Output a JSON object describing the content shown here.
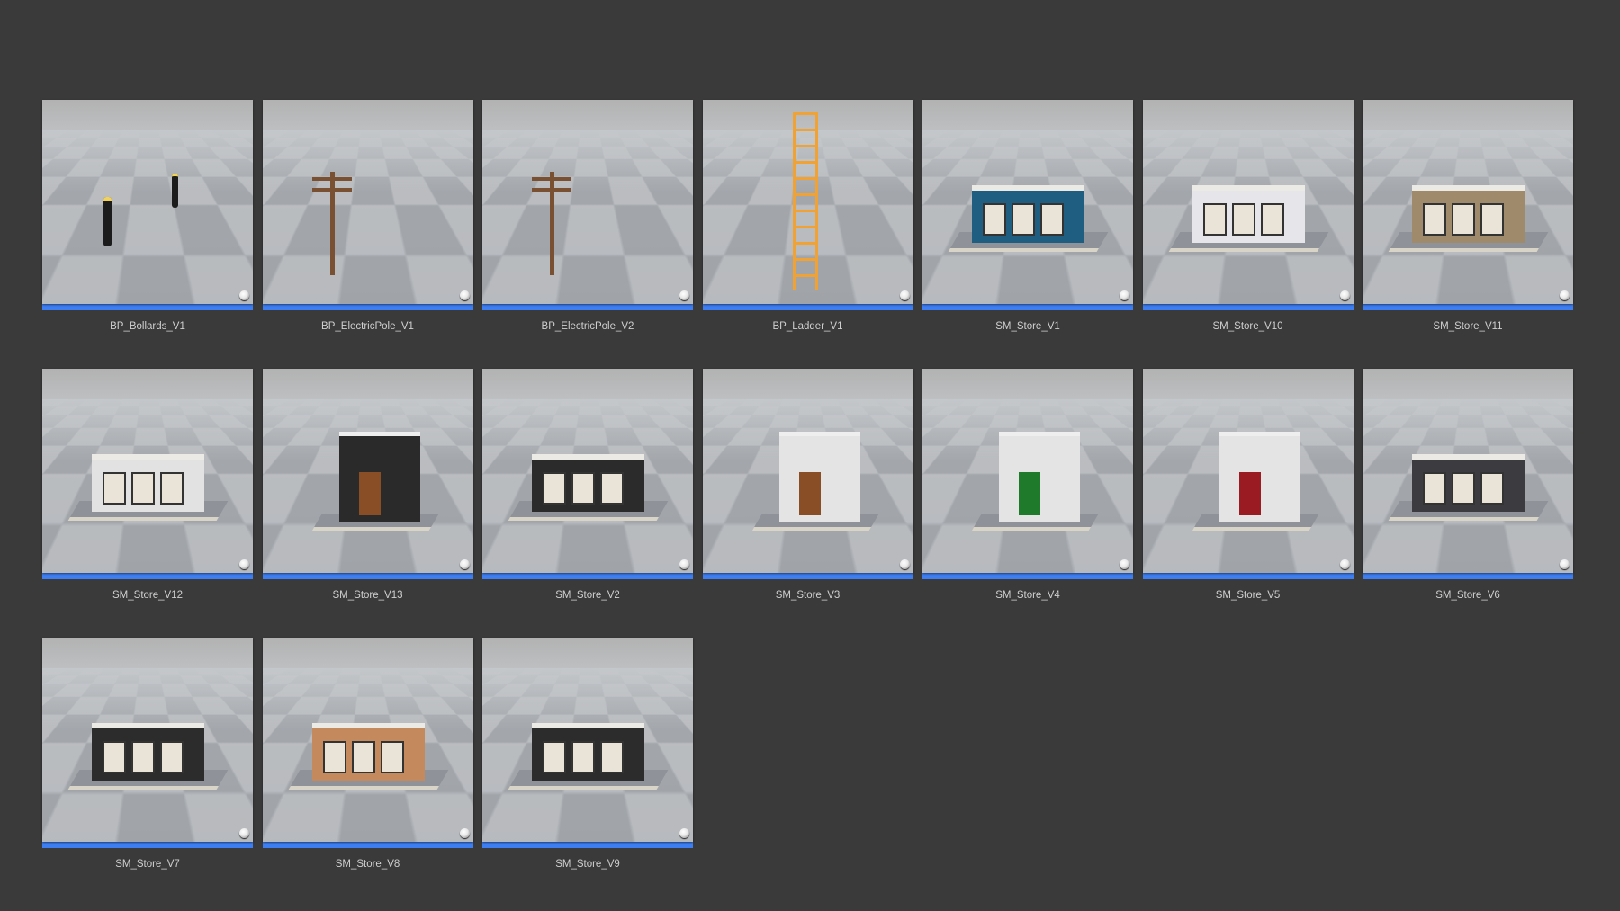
{
  "colors": {
    "background": "#3a3a3a",
    "selection_bar": "#3d7ef2",
    "label_text": "#d0d0d0"
  },
  "assets": [
    {
      "name": "BP_Bollards_V1",
      "kind": "bollards"
    },
    {
      "name": "BP_ElectricPole_V1",
      "kind": "pole"
    },
    {
      "name": "BP_ElectricPole_V2",
      "kind": "pole"
    },
    {
      "name": "BP_Ladder_V1",
      "kind": "ladder"
    },
    {
      "name": "SM_Store_V1",
      "kind": "store",
      "color": "#1f5e80"
    },
    {
      "name": "SM_Store_V10",
      "kind": "store",
      "color": "#e6e6ea"
    },
    {
      "name": "SM_Store_V11",
      "kind": "store",
      "color": "#a08a6c"
    },
    {
      "name": "SM_Store_V12",
      "kind": "store",
      "color": "#e2e2e2"
    },
    {
      "name": "SM_Store_V13",
      "kind": "tall",
      "color": "#2a2a2a",
      "door": "#8a4e26"
    },
    {
      "name": "SM_Store_V2",
      "kind": "store",
      "color": "#2b2b2b"
    },
    {
      "name": "SM_Store_V3",
      "kind": "tall",
      "color": "#e4e4e4",
      "door": "#8a4e26"
    },
    {
      "name": "SM_Store_V4",
      "kind": "tall",
      "color": "#e4e4e4",
      "door": "#1f7a2c"
    },
    {
      "name": "SM_Store_V5",
      "kind": "tall",
      "color": "#e4e4e4",
      "door": "#9a1b22"
    },
    {
      "name": "SM_Store_V6",
      "kind": "store",
      "color": "#3c3c40"
    },
    {
      "name": "SM_Store_V7",
      "kind": "store",
      "color": "#2c2c2c"
    },
    {
      "name": "SM_Store_V8",
      "kind": "store",
      "color": "#c48a5e"
    },
    {
      "name": "SM_Store_V9",
      "kind": "store",
      "color": "#2c2c2c"
    }
  ],
  "icons": {
    "thumbnail_sphere": "material-sphere-icon"
  }
}
